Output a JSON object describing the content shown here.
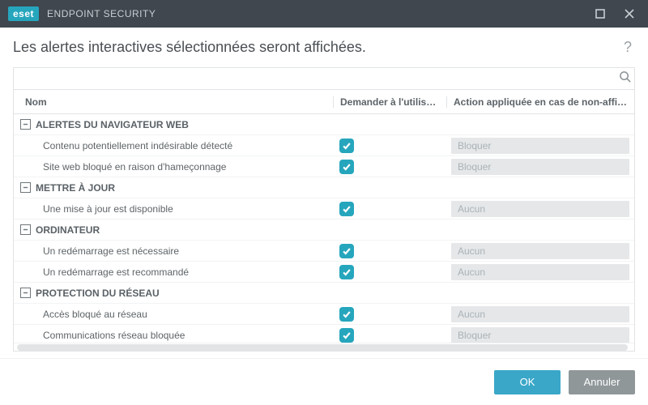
{
  "brand": {
    "logo": "eset",
    "product": "ENDPOINT SECURITY"
  },
  "heading": "Les alertes interactives sélectionnées seront affichées.",
  "search": {
    "placeholder": ""
  },
  "columns": {
    "name": "Nom",
    "ask": "Demander à l'utilisateur",
    "action": "Action appliquée en cas de non-affichage"
  },
  "buttons": {
    "ok": "OK",
    "cancel": "Annuler"
  },
  "groups": [
    {
      "key": "web",
      "label": "ALERTES DU NAVIGATEUR WEB",
      "items": [
        {
          "name": "Contenu potentiellement indésirable détecté",
          "ask": true,
          "action": "Bloquer"
        },
        {
          "name": "Site web bloqué en raison d'hameçonnage",
          "ask": true,
          "action": "Bloquer"
        }
      ]
    },
    {
      "key": "update",
      "label": "METTRE À JOUR",
      "items": [
        {
          "name": "Une mise à jour est disponible",
          "ask": true,
          "action": "Aucun"
        }
      ]
    },
    {
      "key": "computer",
      "label": "ORDINATEUR",
      "items": [
        {
          "name": "Un redémarrage est nécessaire",
          "ask": true,
          "action": "Aucun"
        },
        {
          "name": "Un redémarrage est recommandé",
          "ask": true,
          "action": "Aucun"
        }
      ]
    },
    {
      "key": "network",
      "label": "PROTECTION DU RÉSEAU",
      "items": [
        {
          "name": "Accès bloqué au réseau",
          "ask": true,
          "action": "Aucun"
        },
        {
          "name": "Communications réseau bloquée",
          "ask": true,
          "action": "Bloquer"
        }
      ]
    }
  ]
}
